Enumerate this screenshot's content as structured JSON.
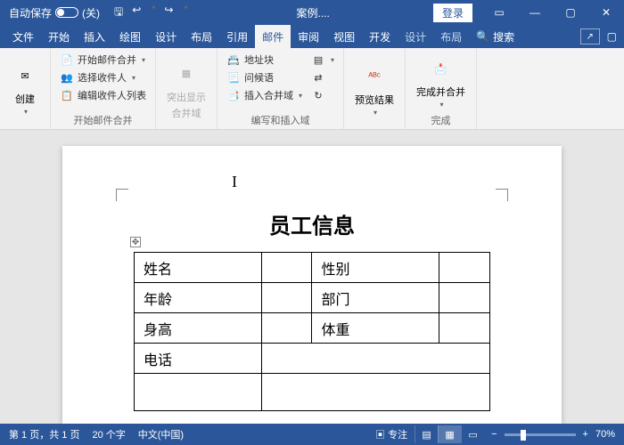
{
  "titlebar": {
    "autosave_label": "自动保存",
    "autosave_state": "关",
    "doc_name": "案例....",
    "login_label": "登录"
  },
  "tabs": {
    "items": [
      "文件",
      "开始",
      "插入",
      "绘图",
      "设计",
      "布局",
      "引用",
      "邮件",
      "审阅",
      "视图",
      "开发",
      "设计",
      "布局"
    ],
    "active_index": 7,
    "search_label": "搜索"
  },
  "ribbon": {
    "create": {
      "label": "创建"
    },
    "start_merge": {
      "label": "开始邮件合并",
      "items": [
        "开始邮件合并",
        "选择收件人",
        "编辑收件人列表"
      ]
    },
    "highlight": {
      "line1": "突出显示",
      "line2": "合并域"
    },
    "write_insert": {
      "label": "编写和插入域",
      "items": [
        "地址块",
        "问候语",
        "插入合并域"
      ]
    },
    "preview": {
      "label": "预览结果"
    },
    "finish": {
      "label": "完成并合并",
      "group_label": "完成"
    }
  },
  "document": {
    "title": "员工信息",
    "labels": {
      "name": "姓名",
      "gender": "性别",
      "age": "年龄",
      "dept": "部门",
      "height": "身高",
      "weight": "体重",
      "phone": "电话"
    }
  },
  "status": {
    "page": "第 1 页，共 1 页",
    "words": "20 个字",
    "lang": "中文(中国)",
    "focus": "专注",
    "zoom": "70%"
  }
}
